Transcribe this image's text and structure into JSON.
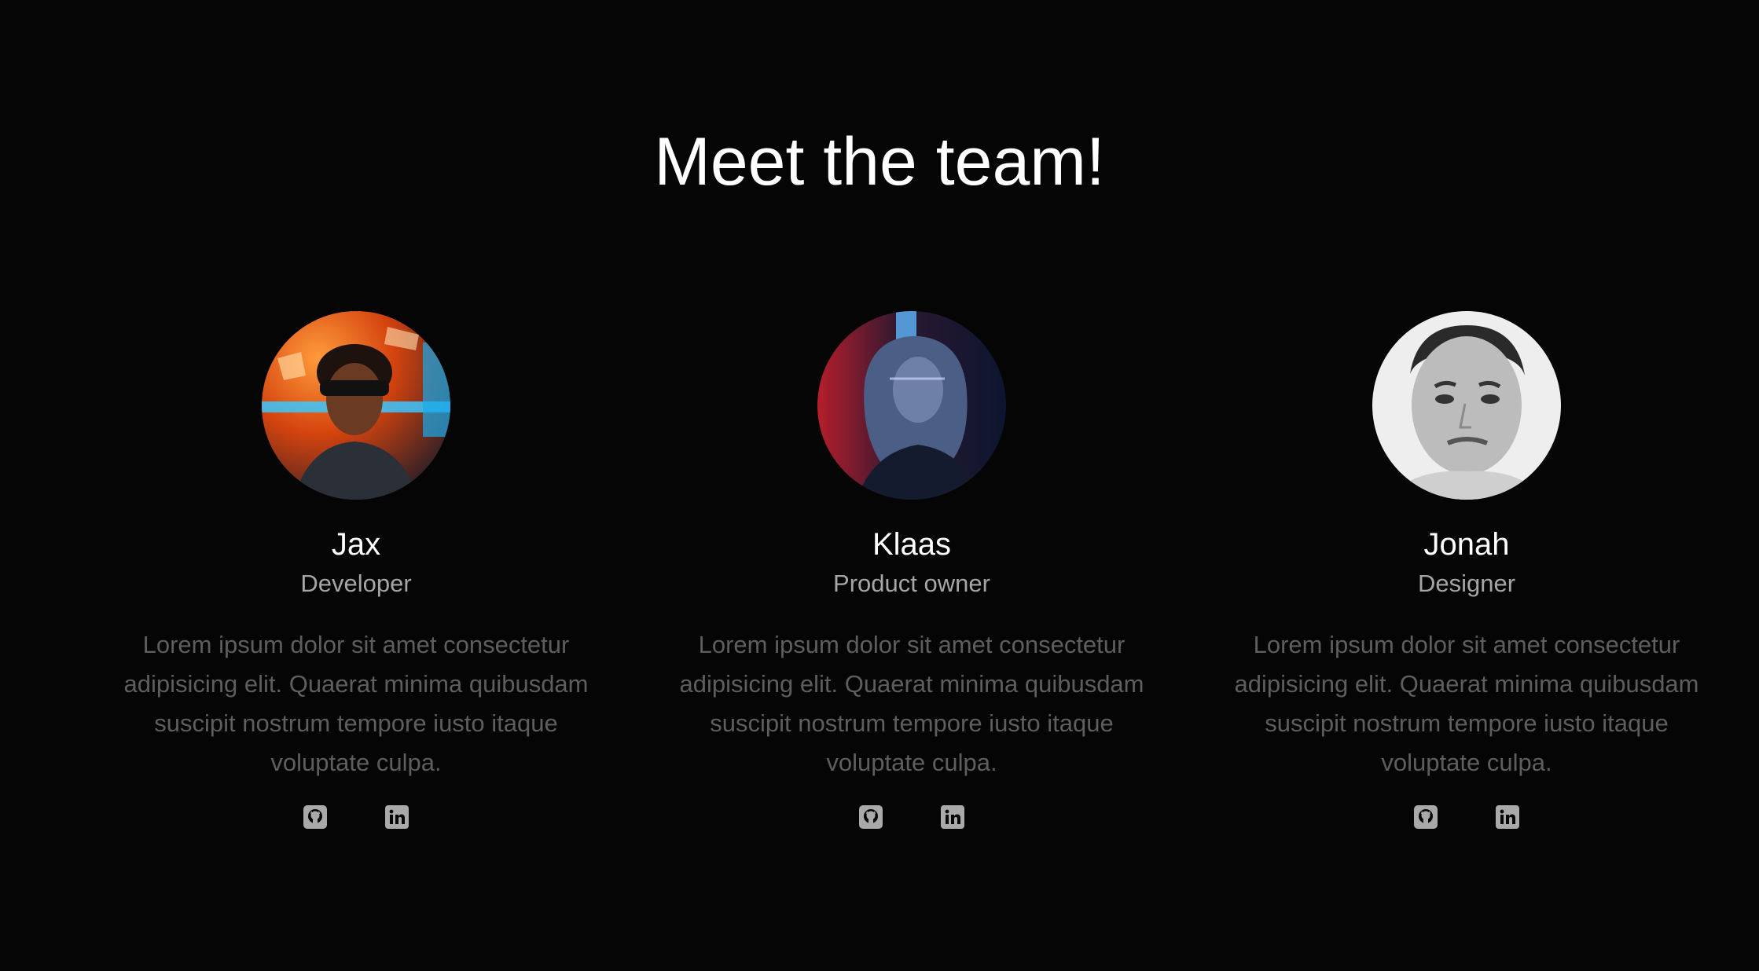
{
  "heading": "Meet the team!",
  "members": [
    {
      "name": "Jax",
      "role": "Developer",
      "bio": "Lorem ipsum dolor sit amet consectetur adipisicing elit. Quaerat minima quibusdam suscipit nostrum tempore iusto itaque voluptate culpa.",
      "links": [
        "github-icon",
        "linkedin-icon"
      ]
    },
    {
      "name": "Klaas",
      "role": "Product owner",
      "bio": "Lorem ipsum dolor sit amet consectetur adipisicing elit. Quaerat minima quibusdam suscipit nostrum tempore iusto itaque voluptate culpa.",
      "links": [
        "github-icon",
        "linkedin-icon"
      ]
    },
    {
      "name": "Jonah",
      "role": "Designer",
      "bio": "Lorem ipsum dolor sit amet consectetur adipisicing elit. Quaerat minima quibusdam suscipit nostrum tempore iusto itaque voluptate culpa.",
      "links": [
        "github-icon",
        "linkedin-icon"
      ]
    }
  ],
  "colors": {
    "background": "#050505",
    "heading": "#ffffff",
    "role": "#a6a6a6",
    "bio": "#5e5e5e",
    "icon": "#a9a9a9"
  }
}
